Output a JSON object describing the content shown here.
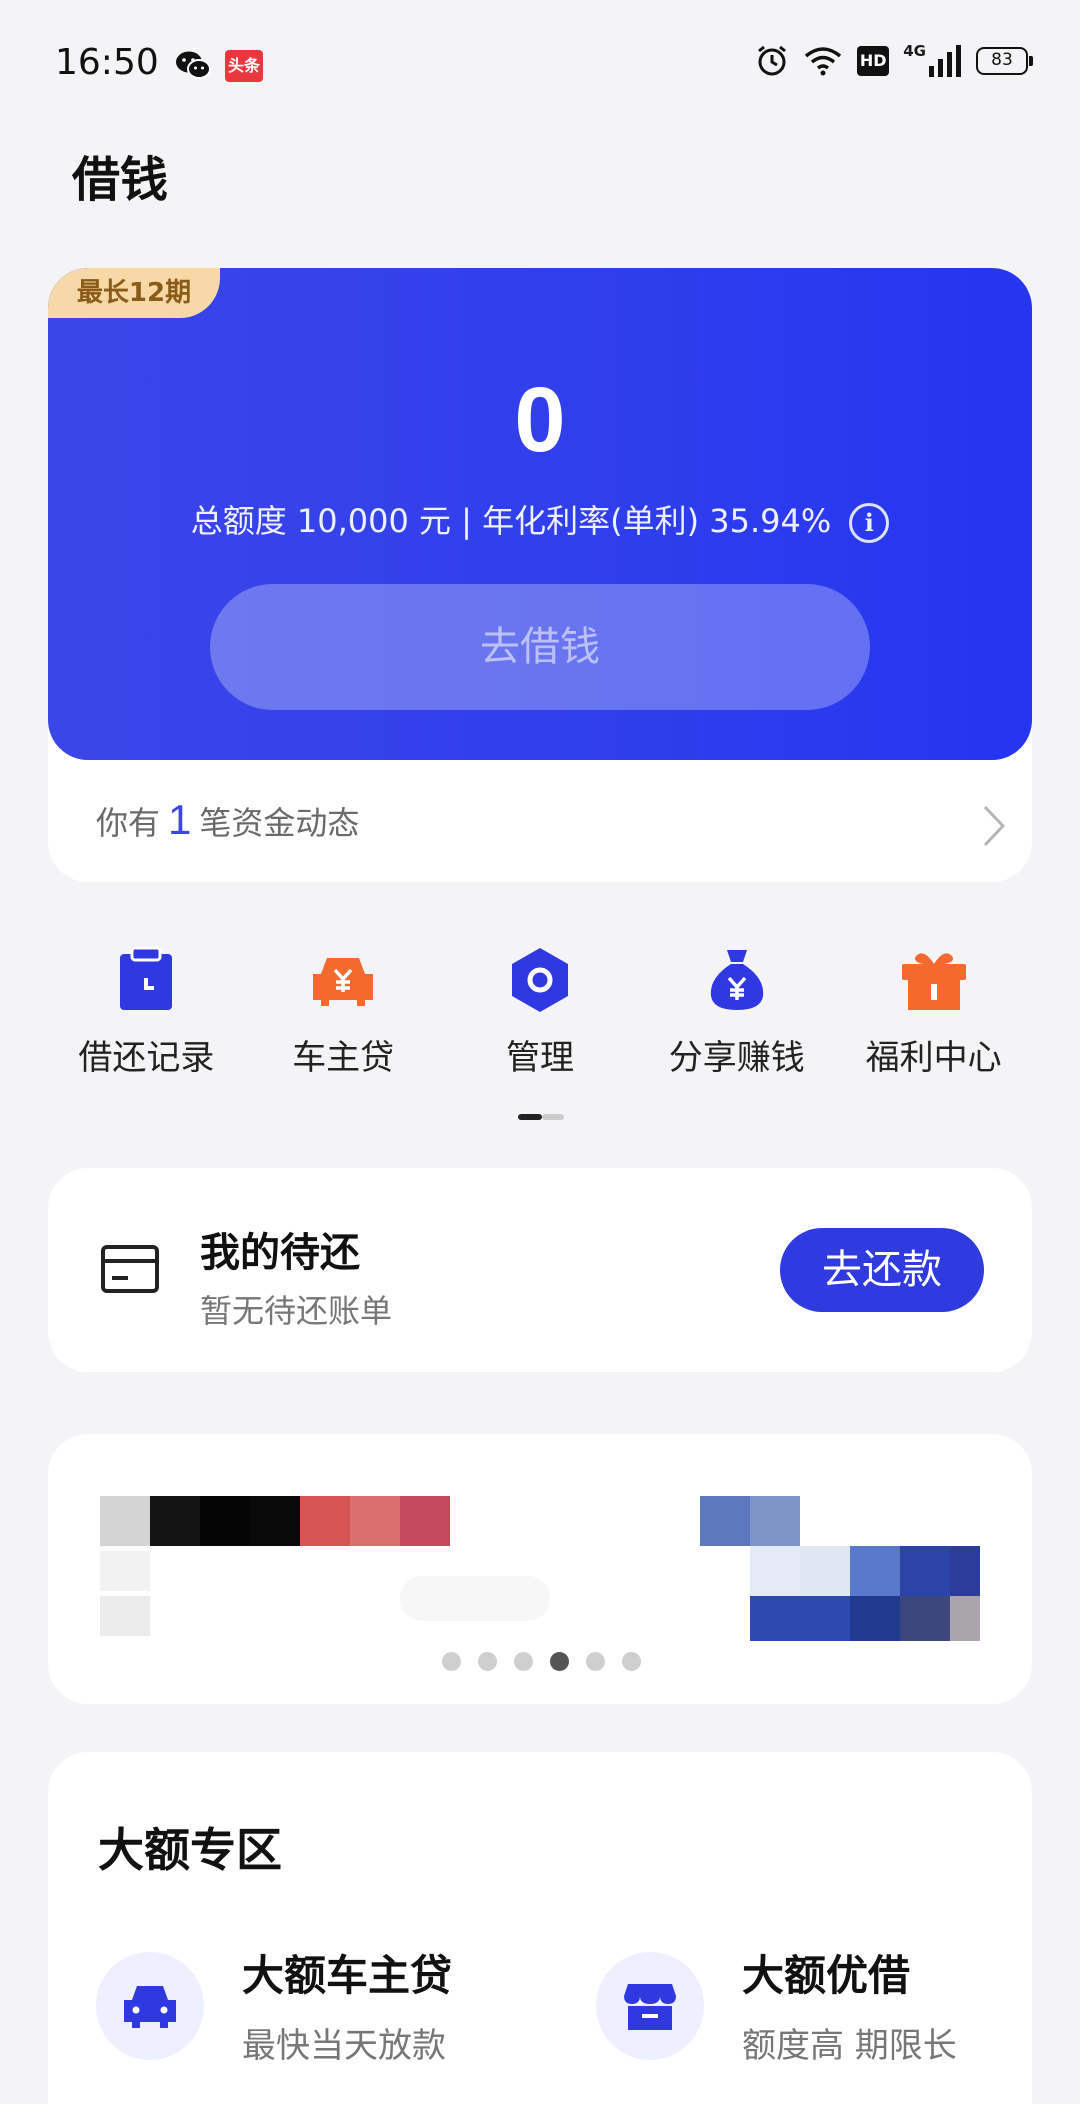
{
  "status_bar": {
    "time": "16:50",
    "news_app_label": "头条",
    "hd_label": "HD",
    "network_label": "4G",
    "battery_level": "83"
  },
  "page": {
    "title": "借钱"
  },
  "loan_card": {
    "term_badge": "最长12期",
    "available_amount": "0",
    "credit_info": "总额度 10,000 元 | 年化利率(单利) 35.94%",
    "info_icon_glyph": "i",
    "borrow_button": "去借钱",
    "activity_prefix": "你有",
    "activity_count": "1",
    "activity_suffix": "笔资金动态",
    "colors": {
      "card_blue": "#2f3eec",
      "badge_gold": "#f7d9a7"
    }
  },
  "quick_menu": {
    "items": [
      {
        "label": "借还记录",
        "icon": "calendar-clock-icon",
        "color": "#3038e0"
      },
      {
        "label": "车主贷",
        "icon": "car-yen-icon",
        "color": "#f4692d"
      },
      {
        "label": "管理",
        "icon": "hexagon-settings-icon",
        "color": "#3038e0"
      },
      {
        "label": "分享赚钱",
        "icon": "money-bag-icon",
        "color": "#3038e0"
      },
      {
        "label": "福利中心",
        "icon": "gift-icon",
        "color": "#f4692d"
      }
    ]
  },
  "repay": {
    "title": "我的待还",
    "subtitle": "暂无待还账单",
    "button": "去还款"
  },
  "banner": {
    "slide_count": 6,
    "active_slide": 4
  },
  "big_section": {
    "title": "大额专区",
    "products": [
      {
        "name": "大额车主贷",
        "desc": "最快当天放款",
        "icon": "car-icon"
      },
      {
        "name": "大额优借",
        "desc": "额度高 期限长",
        "icon": "shop-icon"
      }
    ]
  }
}
